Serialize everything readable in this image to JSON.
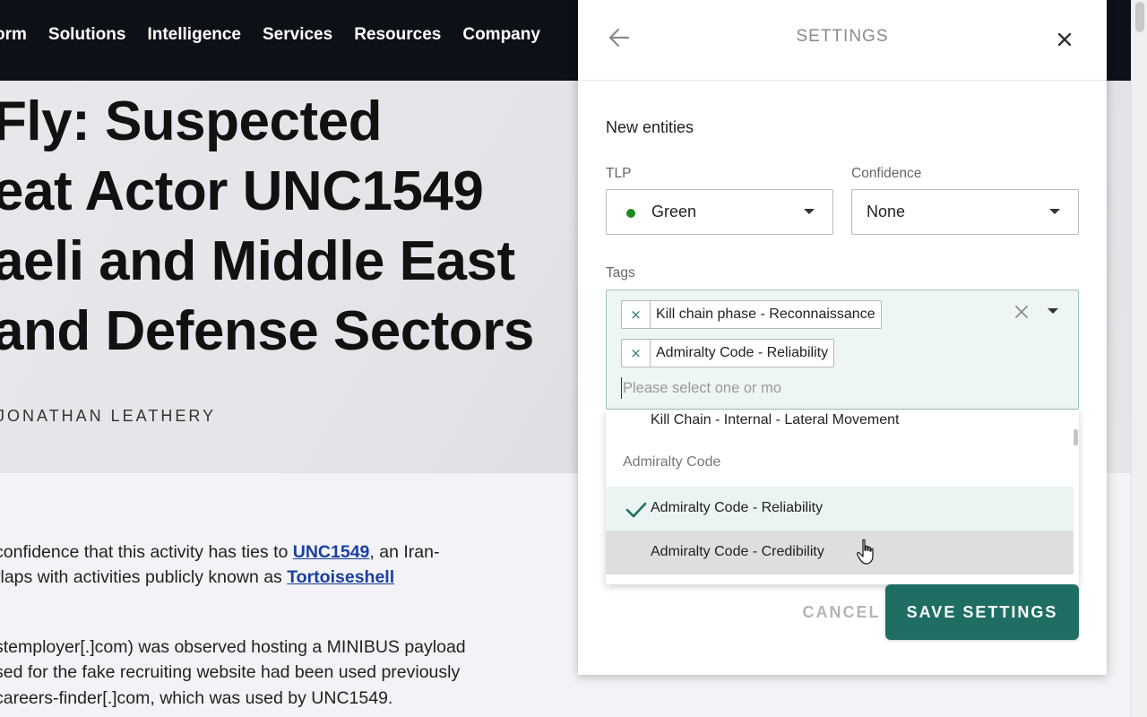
{
  "nav": {
    "items": [
      "orm",
      "Solutions",
      "Intelligence",
      "Services",
      "Resources",
      "Company"
    ]
  },
  "hero": {
    "title_lines": [
      "Fly: Suspected",
      "eat Actor UNC1549",
      "aeli and Middle East",
      "and Defense Sectors"
    ],
    "author": "JONATHAN LEATHERY"
  },
  "article": {
    "p1_line1_pre": "confidence that this activity has ties to ",
    "p1_line1_link": "UNC1549",
    "p1_line1_post": ", an Iran-",
    "p1_line2_pre": "rlaps with activities publicly known as ",
    "p1_line2_link": "Tortoiseshell",
    "p2_lines": [
      "stemployer[.]com) was observed hosting a MINIBUS payload",
      "sed for the fake recruiting website had been used previously",
      "careers-finder[.]com, which was used by UNC1549."
    ]
  },
  "settings": {
    "title": "SETTINGS",
    "section_title": "New entities",
    "tlp": {
      "label": "TLP",
      "value": "Green",
      "dot_color": "#1b8a1b"
    },
    "confidence": {
      "label": "Confidence",
      "value": "None"
    },
    "tags": {
      "label": "Tags",
      "selected": [
        "Kill chain phase - Reconnaissance",
        "Admiralty Code - Reliability"
      ],
      "placeholder": "Please select one or mo"
    },
    "dropdown": {
      "partial_item": "Kill Chain - Internal - Lateral Movement",
      "group_label": "Admiralty Code",
      "items": [
        {
          "label": "Admiralty Code - Reliability",
          "selected": true
        },
        {
          "label": "Admiralty Code - Credibility",
          "hovered": true
        }
      ]
    },
    "cancel_label": "CANCEL",
    "save_label": "SAVE SETTINGS"
  },
  "colors": {
    "accent": "#1f6e64",
    "nav_bg": "#0d1117",
    "link": "#1a3fa0"
  }
}
